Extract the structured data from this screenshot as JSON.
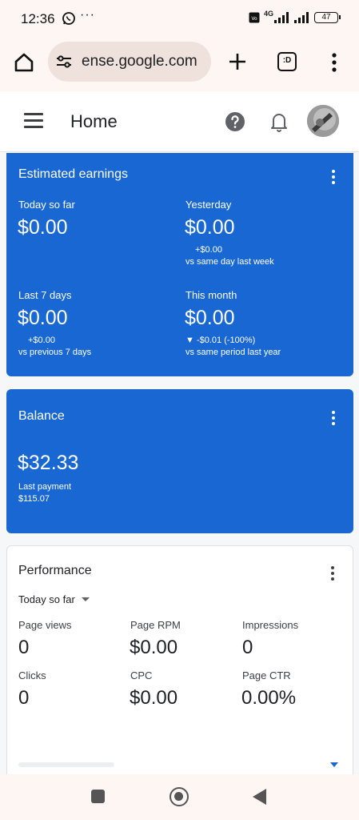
{
  "status_bar": {
    "time": "12:36",
    "more": "···",
    "network": "4G",
    "battery": "47"
  },
  "browser": {
    "url": "ense.google.com",
    "tabs_label": ":D"
  },
  "header": {
    "title": "Home"
  },
  "estimated_earnings": {
    "title": "Estimated earnings",
    "today_label": "Today so far",
    "today_value": "$0.00",
    "yesterday_label": "Yesterday",
    "yesterday_value": "$0.00",
    "yesterday_delta": "+$0.00",
    "yesterday_note": "vs same day last week",
    "last7_label": "Last 7 days",
    "last7_value": "$0.00",
    "last7_delta": "+$0.00",
    "last7_note": "vs previous 7 days",
    "month_label": "This month",
    "month_value": "$0.00",
    "month_delta": "▼ -$0.01 (-100%)",
    "month_note": "vs same period last year"
  },
  "balance": {
    "title": "Balance",
    "value": "$32.33",
    "last_payment_label": "Last payment",
    "last_payment_value": "$115.07"
  },
  "performance": {
    "title": "Performance",
    "period": "Today so far",
    "page_views_label": "Page views",
    "page_views_value": "0",
    "page_rpm_label": "Page RPM",
    "page_rpm_value": "$0.00",
    "impressions_label": "Impressions",
    "impressions_value": "0",
    "clicks_label": "Clicks",
    "clicks_value": "0",
    "cpc_label": "CPC",
    "cpc_value": "$0.00",
    "ctr_label": "Page CTR",
    "ctr_value": "0.00%"
  },
  "colors": {
    "card_blue": "#1967d2",
    "browser_bg": "#fdf6f3",
    "url_pill": "#efe2dd"
  },
  "icons": [
    "whatsapp-icon",
    "home-icon",
    "tune-icon",
    "plus-icon",
    "tabs-icon",
    "more-vert-icon",
    "menu-icon",
    "help-icon",
    "bell-icon",
    "avatar",
    "square-nav-icon",
    "circle-nav-icon",
    "back-nav-icon"
  ]
}
